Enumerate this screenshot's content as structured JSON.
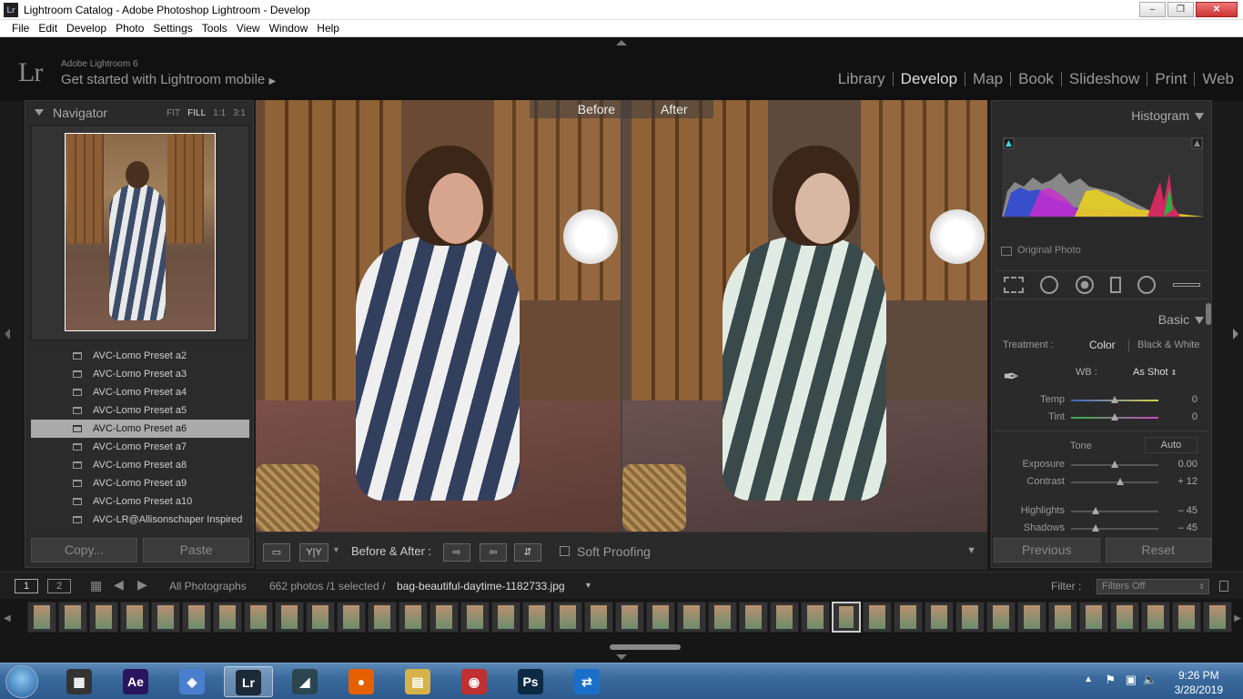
{
  "window": {
    "title": "Lightroom Catalog - Adobe Photoshop Lightroom - Develop",
    "icon": "Lr"
  },
  "menubar": [
    "File",
    "Edit",
    "Develop",
    "Photo",
    "Settings",
    "Tools",
    "View",
    "Window",
    "Help"
  ],
  "identity": {
    "logo": "Lr",
    "version": "Adobe Lightroom 6",
    "mobile_prompt": "Get started with Lightroom mobile"
  },
  "modules": [
    {
      "label": "Library",
      "active": false
    },
    {
      "label": "Develop",
      "active": true
    },
    {
      "label": "Map",
      "active": false
    },
    {
      "label": "Book",
      "active": false
    },
    {
      "label": "Slideshow",
      "active": false
    },
    {
      "label": "Print",
      "active": false
    },
    {
      "label": "Web",
      "active": false
    }
  ],
  "navigator": {
    "title": "Navigator",
    "zoom_options": [
      "FIT",
      "FILL",
      "1:1",
      "3:1"
    ],
    "active_zoom": "FILL"
  },
  "presets": [
    {
      "label": "AVC-Lomo Preset a2",
      "selected": false
    },
    {
      "label": "AVC-Lomo Preset a3",
      "selected": false
    },
    {
      "label": "AVC-Lomo Preset a4",
      "selected": false
    },
    {
      "label": "AVC-Lomo Preset a5",
      "selected": false
    },
    {
      "label": "AVC-Lomo Preset a6",
      "selected": true
    },
    {
      "label": "AVC-Lomo Preset a7",
      "selected": false
    },
    {
      "label": "AVC-Lomo Preset a8",
      "selected": false
    },
    {
      "label": "AVC-Lomo Preset a9",
      "selected": false
    },
    {
      "label": "AVC-Lomo Preset a10",
      "selected": false
    },
    {
      "label": "AVC-LR@Allisonschaper Inspired",
      "selected": false
    }
  ],
  "left_buttons": {
    "copy": "Copy...",
    "paste": "Paste"
  },
  "view": {
    "before_label": "Before",
    "after_label": "After"
  },
  "toolbar": {
    "yy": "Y|Y",
    "before_after": "Before & After :",
    "soft_proofing": "Soft Proofing"
  },
  "histogram": {
    "title": "Histogram",
    "original_photo": "Original Photo"
  },
  "basic": {
    "title": "Basic",
    "treatment_label": "Treatment :",
    "treatment_color": "Color",
    "treatment_bw": "Black & White",
    "wb_label": "WB :",
    "wb_value": "As Shot",
    "tone_label": "Tone",
    "auto_label": "Auto",
    "sliders": [
      {
        "label": "Temp",
        "value": "0",
        "position": 0.5
      },
      {
        "label": "Tint",
        "value": "0",
        "position": 0.5
      },
      {
        "label": "Exposure",
        "value": "0.00",
        "position": 0.5
      },
      {
        "label": "Contrast",
        "value": "+ 12",
        "position": 0.56
      },
      {
        "label": "Highlights",
        "value": "– 45",
        "position": 0.28
      },
      {
        "label": "Shadows",
        "value": "– 45",
        "position": 0.28
      }
    ]
  },
  "right_buttons": {
    "previous": "Previous",
    "reset": "Reset"
  },
  "filmbar": {
    "view1": "1",
    "view2": "2",
    "source": "All Photographs",
    "count": "662 photos /1 selected /",
    "filename": "bag-beautiful-daytime-1182733.jpg",
    "filter_label": "Filter :",
    "filter_value": "Filters Off"
  },
  "taskbar": {
    "apps": [
      {
        "name": "Windows Movie Maker",
        "glyph": "▦",
        "color": "#333"
      },
      {
        "name": "After Effects",
        "glyph": "Ae",
        "color": "#2a1660"
      },
      {
        "name": "Connector",
        "glyph": "◈",
        "color": "#4a7fd0"
      },
      {
        "name": "Lightroom",
        "glyph": "Lr",
        "color": "#1c2a38"
      },
      {
        "name": "Filmora",
        "glyph": "◢",
        "color": "#2b4650"
      },
      {
        "name": "Firefox",
        "glyph": "●",
        "color": "#e66000"
      },
      {
        "name": "Explorer",
        "glyph": "▤",
        "color": "#d7b24a"
      },
      {
        "name": "Camera",
        "glyph": "◉",
        "color": "#c03030"
      },
      {
        "name": "Photoshop",
        "glyph": "Ps",
        "color": "#0c2a44"
      },
      {
        "name": "TeamViewer",
        "glyph": "⇄",
        "color": "#1a70c8"
      }
    ],
    "time": "9:26 PM",
    "date": "3/28/2019"
  }
}
